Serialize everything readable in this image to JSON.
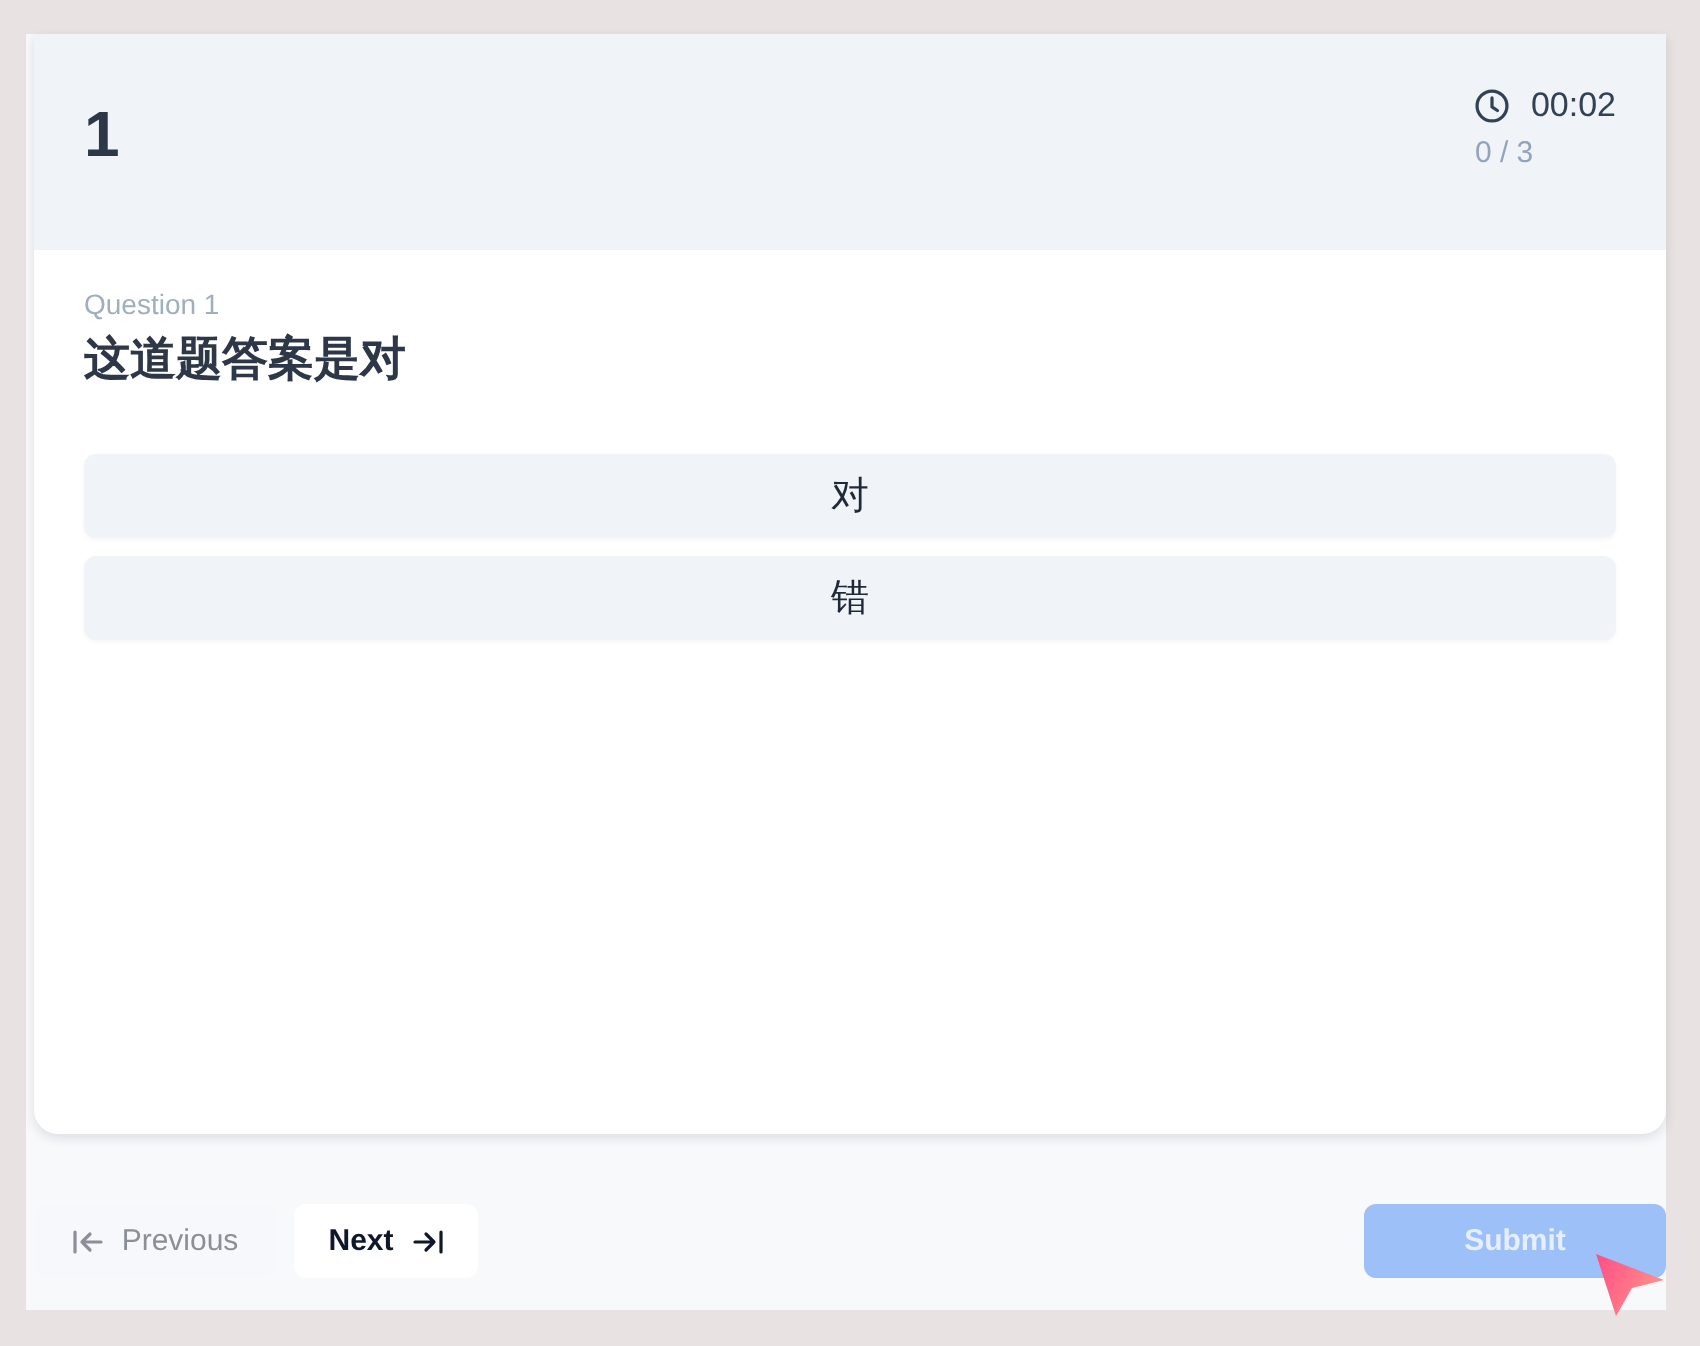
{
  "header": {
    "question_number": "1",
    "timer": "00:02",
    "progress": "0 / 3"
  },
  "question": {
    "label": "Question 1",
    "text": "这道题答案是对",
    "options": [
      {
        "label": "对",
        "selected": false
      },
      {
        "label": "错",
        "selected": false
      }
    ]
  },
  "footer": {
    "previous": {
      "label": "Previous",
      "disabled": true
    },
    "next": {
      "label": "Next",
      "disabled": false
    },
    "submit": {
      "label": "Submit",
      "disabled": true
    }
  }
}
